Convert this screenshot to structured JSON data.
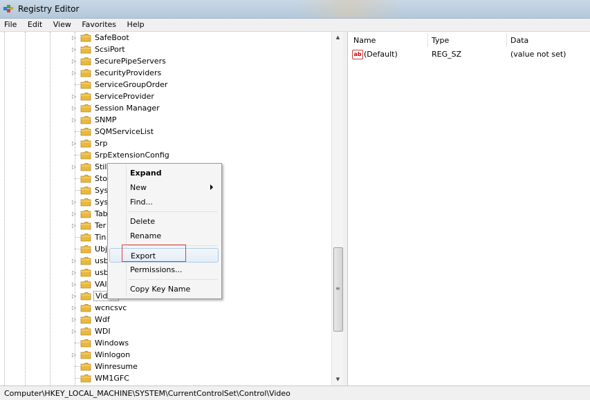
{
  "window": {
    "title": "Registry Editor"
  },
  "menu": [
    "File",
    "Edit",
    "View",
    "Favorites",
    "Help"
  ],
  "tree": {
    "items": [
      {
        "label": "SafeBoot",
        "expandable": true
      },
      {
        "label": "ScsiPort",
        "expandable": true
      },
      {
        "label": "SecurePipeServers",
        "expandable": true
      },
      {
        "label": "SecurityProviders",
        "expandable": true
      },
      {
        "label": "ServiceGroupOrder",
        "expandable": false
      },
      {
        "label": "ServiceProvider",
        "expandable": true
      },
      {
        "label": "Session Manager",
        "expandable": true
      },
      {
        "label": "SNMP",
        "expandable": true
      },
      {
        "label": "SQMServiceList",
        "expandable": false
      },
      {
        "label": "Srp",
        "expandable": true
      },
      {
        "label": "SrpExtensionConfig",
        "expandable": false
      },
      {
        "label": "Stil",
        "expandable": true
      },
      {
        "label": "Sto",
        "expandable": false
      },
      {
        "label": "Sys",
        "expandable": false
      },
      {
        "label": "Sys",
        "expandable": true
      },
      {
        "label": "Tab",
        "expandable": true
      },
      {
        "label": "Ter",
        "expandable": true
      },
      {
        "label": "Tin",
        "expandable": false
      },
      {
        "label": "Ubj",
        "expandable": false
      },
      {
        "label": "usb",
        "expandable": true
      },
      {
        "label": "usb",
        "expandable": true
      },
      {
        "label": "VAI",
        "expandable": true
      },
      {
        "label": "Video",
        "expandable": true,
        "selected": true
      },
      {
        "label": "wcncsvc",
        "expandable": true
      },
      {
        "label": "Wdf",
        "expandable": true
      },
      {
        "label": "WDI",
        "expandable": true
      },
      {
        "label": "Windows",
        "expandable": false
      },
      {
        "label": "Winlogon",
        "expandable": true
      },
      {
        "label": "Winresume",
        "expandable": false
      },
      {
        "label": "WM1GFC",
        "expandable": false
      }
    ]
  },
  "values_pane": {
    "columns": [
      "Name",
      "Type",
      "Data"
    ],
    "rows": [
      {
        "name": "(Default)",
        "type": "REG_SZ",
        "data": "(value not set)",
        "icon": "string-value-icon"
      }
    ]
  },
  "context_menu": {
    "items": [
      {
        "label": "Expand",
        "bold": true
      },
      {
        "label": "New",
        "submenu": true
      },
      {
        "label": "Find..."
      },
      {
        "label": "Delete"
      },
      {
        "label": "Rename"
      },
      {
        "label": "Export",
        "highlighted": true
      },
      {
        "label": "Permissions..."
      },
      {
        "label": "Copy Key Name"
      }
    ]
  },
  "status_bar": {
    "path": "Computer\\HKEY_LOCAL_MACHINE\\SYSTEM\\CurrentControlSet\\Control\\Video"
  },
  "colors": {
    "highlight_box": "#d93c3c",
    "folder": "#e8b93c",
    "menu_highlight": "#aecbe8"
  }
}
